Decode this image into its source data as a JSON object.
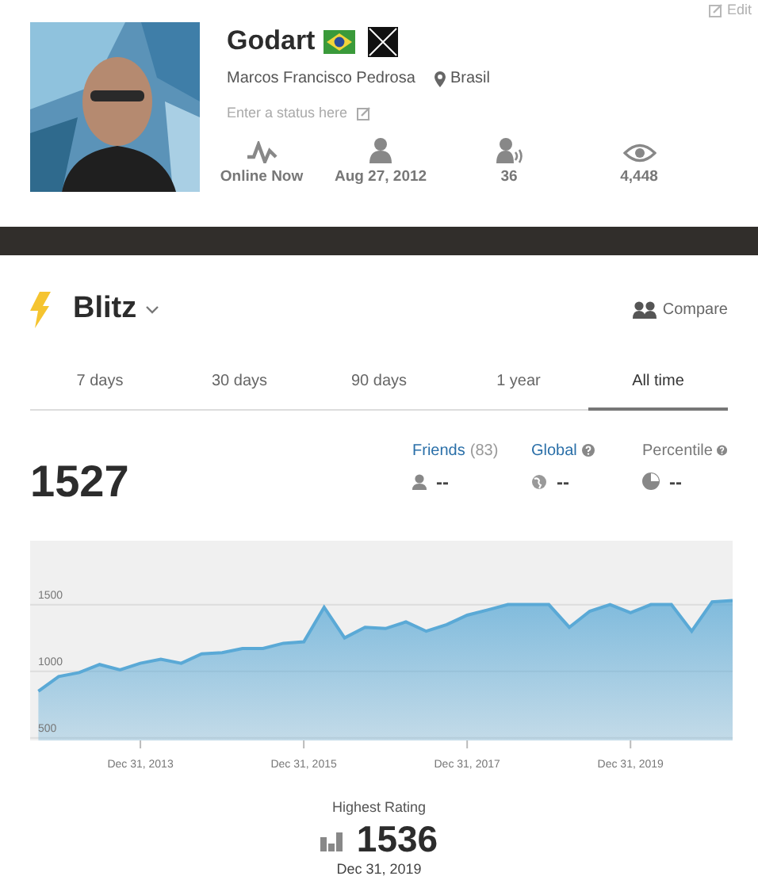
{
  "profile": {
    "edit": "Edit",
    "username": "Godart",
    "full_name": "Marcos Francisco Pedrosa",
    "location": "Brasil",
    "status_placeholder": "Enter a status here",
    "stats": [
      {
        "kind": "online",
        "label": "Online Now"
      },
      {
        "kind": "joined",
        "label": "Aug 27, 2012"
      },
      {
        "kind": "friends",
        "label": "36"
      },
      {
        "kind": "views",
        "label": "4,448"
      }
    ]
  },
  "game": {
    "title": "Blitz",
    "compare": "Compare"
  },
  "tabs": [
    {
      "label": "7 days",
      "selected": false
    },
    {
      "label": "30 days",
      "selected": false
    },
    {
      "label": "90 days",
      "selected": false
    },
    {
      "label": "1 year",
      "selected": false
    },
    {
      "label": "All time",
      "selected": true
    }
  ],
  "rating": "1527",
  "ranks": [
    {
      "kind": "friends",
      "label": "Friends",
      "count": "(83)",
      "value": "--"
    },
    {
      "kind": "global",
      "label": "Global",
      "value": "--"
    },
    {
      "kind": "percentile",
      "label": "Percentile",
      "value": "--"
    }
  ],
  "chart_data": {
    "type": "area",
    "ylim": [
      480,
      1980
    ],
    "yticks": [
      500,
      1000,
      1500
    ],
    "categories": [
      null,
      null,
      null,
      null,
      null,
      "Dec 31, 2013",
      null,
      null,
      null,
      null,
      null,
      null,
      null,
      "Dec 31, 2015",
      null,
      null,
      null,
      null,
      null,
      null,
      null,
      "Dec 31, 2017",
      null,
      null,
      null,
      null,
      null,
      null,
      null,
      "Dec 31, 2019",
      null,
      null,
      null,
      null,
      null
    ],
    "series": [
      {
        "color": "#5aa9d6",
        "values": [
          850,
          960,
          990,
          1050,
          1010,
          1060,
          1090,
          1060,
          1130,
          1140,
          1170,
          1170,
          1210,
          1220,
          1480,
          1250,
          1330,
          1320,
          1370,
          1300,
          1350,
          1420,
          1460,
          1500,
          1500,
          1500,
          1330,
          1450,
          1500,
          1440,
          1500,
          1500,
          1300,
          1520,
          1530
        ]
      }
    ]
  },
  "highest": {
    "label": "Highest Rating",
    "value": "1536",
    "date": "Dec 31, 2019"
  }
}
